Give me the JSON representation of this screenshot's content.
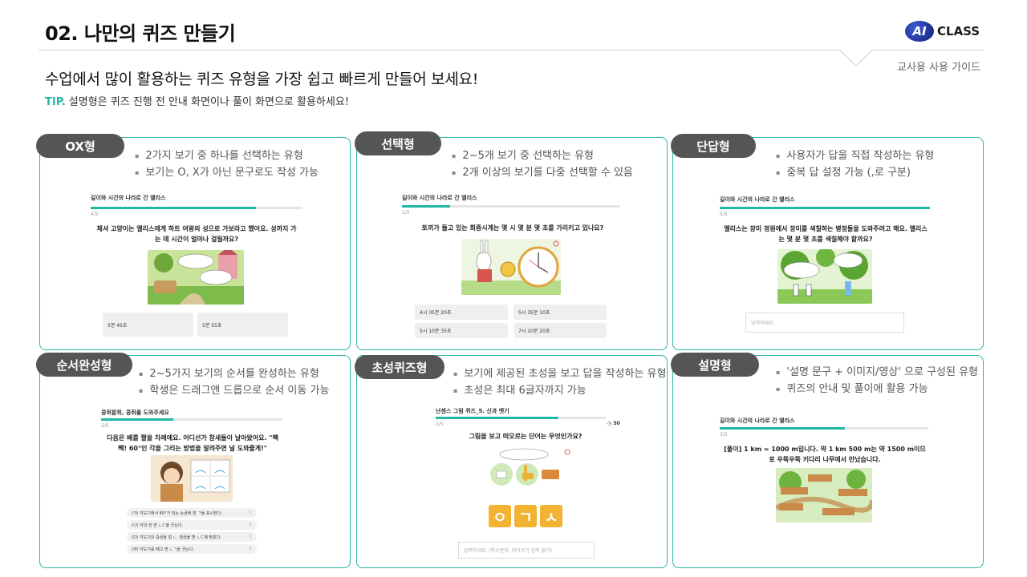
{
  "header": {
    "title": "02. 나만의 퀴즈 만들기",
    "logo_badge": "AI",
    "logo_text": "CLASS",
    "guide": "교사용 사용 가이드"
  },
  "subtitle": "수업에서 많이 활용하는 퀴즈 유형을 가장 쉽고 빠르게 만들어 보세요!",
  "tip": {
    "label": "TIP.",
    "text": "설명형은 퀴즈 진행 전 안내 화면이나 풀이 화면으로 활용하세요!"
  },
  "colors": {
    "accent": "#1fb8a6",
    "pill": "#555555"
  },
  "cards": {
    "ox": {
      "pill": "OX형",
      "bullets": [
        "2가지 보기 중 하나를 선택하는 유형",
        "보기는 O, X가 아닌 문구로도 작성 가능"
      ],
      "quiz_title": "길이와 시간의 나라로 간 앨리스",
      "count": "4/5",
      "progress": 0.78,
      "question": "체셔 고양이는 앨리스에게 하트 여왕의 성으로 가보라고 했어요. 성까지 가는 데 시간이 얼마나 걸릴까요?",
      "options": [
        "5분 45초",
        "5분 55초"
      ]
    },
    "choice": {
      "pill": "선택형",
      "bullets": [
        "2~5개 보기 중 선택하는 유형",
        "2개 이상의 보기를 다중 선택할 수 있음"
      ],
      "quiz_title": "길이와 시간의 나라로 간 앨리스",
      "count": "1/5",
      "progress": 0.22,
      "question": "토끼가 들고 있는 회중시계는 몇 시 몇 분 몇 초를 가리키고 있나요?",
      "options": [
        "4시 35분 20초",
        "5시 35분 10초",
        "5시 10분 35초",
        "7시 10분 20초"
      ]
    },
    "short": {
      "pill": "단답형",
      "bullets": [
        "사용자가 답을 직접 작성하는 유형",
        "중복 답 설정 가능 (,로 구분)"
      ],
      "quiz_title": "길이와 시간의 나라로 간 앨리스",
      "count": "5/5",
      "progress": 1.0,
      "question": "앨리스는 장미 정원에서 장미를 색칠하는 병정들을 도와주려고 해요. 앨리스는 몇 분 몇 초를 색칠해야 할까요?",
      "placeholder": "입력하세요."
    },
    "order": {
      "pill": "순서완성형",
      "bullets": [
        "2~5가지 보기의 순서를 완성하는 유형",
        "학생은 드래그앤 드롭으로 순서 이동 가능"
      ],
      "quiz_title": "콩쥐팥쥐, 콩쥐를 도와주세요",
      "count": "2/5",
      "progress": 0.4,
      "question": "다음은 베를 짤을 차례에요. 어디선가 참새들이 날아왔어요. \"짹짹! 60°인 각을 그리는 방법을 알려주면 널 도와줄게!\"",
      "items": [
        "(가) 각도기에서 60°가 되는 눈금에 점 ㄱ을 표시한다.",
        "(나) 각의 한 변 ㄴㄷ을 긋는다.",
        "(다) 각도기의 중심을 점 ㄴ, 밑금을 변 ㄴㄷ에 맞춘다.",
        "(라) 각도기를 떼고 변 ㄴㄱ을 긋는다."
      ]
    },
    "initial": {
      "pill": "초성퀴즈형",
      "bullets": [
        "보기에 제공된 초성을 보고 답을 작성하는 유형",
        "초성은 최대 6글자까지 가능"
      ],
      "quiz_title": "난센스 그림 퀴즈_5. 신과 옛기",
      "count": "2/5",
      "progress": 0.72,
      "timer": "50",
      "question": "그림을 보고 떠오르는 단어는 무엇인가요?",
      "tiles": [
        "ㅇ",
        "ㄱ",
        "ㅅ"
      ],
      "placeholder": "입력하세요. (특수문자, 띄어쓰기 입력 불가)"
    },
    "explain": {
      "pill": "설명형",
      "bullets": [
        "'설명 문구 + 이미지/영상' 으로 구성된 유형",
        "퀴즈의 안내 및 풀이에 활용 가능"
      ],
      "quiz_title": "길이와 시간의 나라로 간 앨리스",
      "count": "3/5",
      "progress": 0.6,
      "question": "[풀이] 1 km = 1000 m입니다. 약 1 km 500 m는 약 1500 m이므로 우뚝우뚝 키다리 나무에서 만났습니다."
    }
  }
}
